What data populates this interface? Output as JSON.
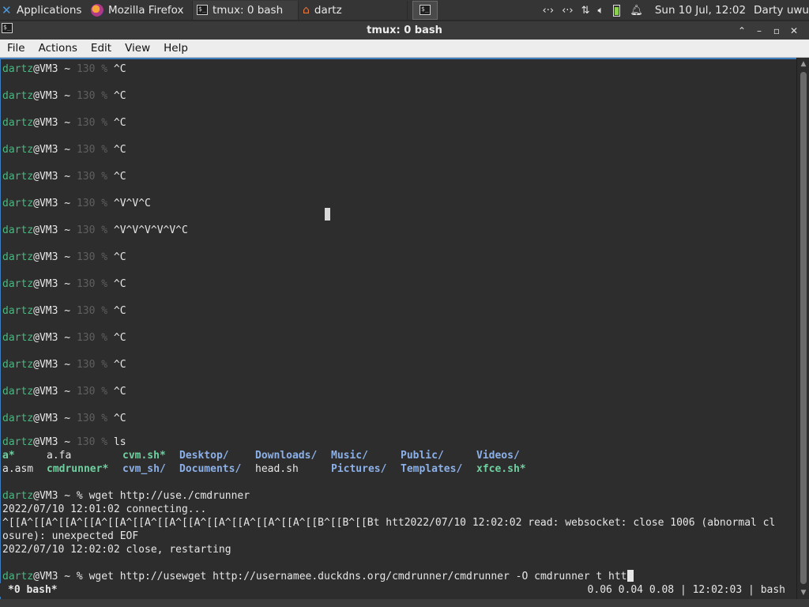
{
  "panel": {
    "applications_label": "Applications",
    "tasks": [
      {
        "label": "Mozilla Firefox",
        "icon": "firefox-icon"
      },
      {
        "label": "tmux: 0 bash",
        "icon": "terminal-icon"
      },
      {
        "label": "dartz",
        "icon": "home-folder-icon"
      }
    ],
    "clock": "Sun 10 Jul, 12:02",
    "user": "Darty uwu"
  },
  "window": {
    "title": "tmux: 0 bash",
    "menus": [
      "File",
      "Actions",
      "Edit",
      "View",
      "Help"
    ]
  },
  "prompt": {
    "user": "dartz",
    "host": "@VM3",
    "dir": " ~ ",
    "code": "130 %",
    "sep": " ~ % "
  },
  "terminal": {
    "ctrl_c_lines": [
      "^C",
      "^C",
      "^C",
      "^C",
      "^C",
      "^V^V^C",
      "^V^V^V^V^V^C",
      "^C",
      "^C",
      "^C",
      "^C",
      "^C",
      "^C",
      "^C"
    ],
    "ls_command": "ls",
    "ls_row1": [
      "a*",
      "a.fa",
      "cvm.sh*",
      "Desktop/",
      "Downloads/",
      "Music/",
      "Public/",
      "Videos/"
    ],
    "ls_row2": [
      "a.asm",
      "cmdrunner*",
      "cvm_sh/",
      "Documents/",
      "head.sh",
      "Pictures/",
      "Templates/",
      "xfce.sh*"
    ],
    "wget1_command": "wget http://use./cmdrunner",
    "output1": "2022/07/10 12:01:02 connecting...",
    "output2": "^[[A^[[A^[[A^[[A^[[A^[[A^[[A^[[A^[[A^[[A^[[A^[[A^[[B^[[B^[[Bt htt2022/07/10 12:02:02 read: websocket: close 1006 (abnormal cl",
    "output3": "osure): unexpected EOF",
    "output4": "2022/07/10 12:02:02 close, restarting",
    "current_command": "wget http://usewget http://usernamee.duckdns.org/cmdrunner/cmdrunner -O cmdrunner t htt"
  },
  "status": {
    "left": "*0 bash*",
    "right": "0.06 0.04 0.08 | 12:02:03 | bash"
  },
  "colors": {
    "prompt_user": "#49b880",
    "executable": "#6fd0a0",
    "directory": "#8cb0e8",
    "terminal_bg": "#2d2d2d",
    "focus_border": "#3f7dbf"
  }
}
